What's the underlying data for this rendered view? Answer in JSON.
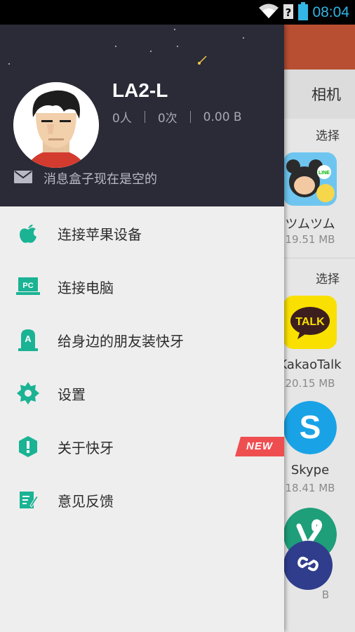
{
  "status_bar": {
    "time": "08:04",
    "icons": [
      "wifi-icon",
      "no-signal-icon",
      "battery-icon"
    ],
    "accent": "#33b5e5"
  },
  "background_app": {
    "tab_label": "相机",
    "sections": [
      {
        "select_label": "选择",
        "app_name": "ツムツム",
        "app_size": "19.51 MB",
        "icon": "tsum-tsum-app-icon"
      },
      {
        "select_label": "选择",
        "app_name": "KakaoTalk",
        "app_size": "20.15 MB",
        "icon": "kakaotalk-app-icon"
      },
      {
        "app_name": "Skype",
        "app_size": "18.41 MB",
        "icon": "skype-app-icon"
      },
      {
        "app_size_partial": "B",
        "icon": "vine-app-icon"
      }
    ],
    "kakao_icon_text": "TALK",
    "fab_icon": "link-icon",
    "header_color": "#b84f33"
  },
  "drawer": {
    "header_bg": "#2b2a37",
    "user": {
      "name": "LA2-L",
      "stats": [
        "0人",
        "0次",
        "0.00 B"
      ],
      "avatar_icon": "cartoon-avatar"
    },
    "inbox_text": "消息盒子现在是空的",
    "accent_color": "#1ab394",
    "menu": [
      {
        "label": "连接苹果设备",
        "icon": "apple-icon"
      },
      {
        "label": "连接电脑",
        "icon": "pc-icon",
        "icon_text": "PC"
      },
      {
        "label": "给身边的朋友装快牙",
        "icon": "install-icon",
        "icon_text": "A"
      },
      {
        "label": "设置",
        "icon": "gear-icon"
      },
      {
        "label": "关于快牙",
        "icon": "info-icon",
        "badge": "NEW",
        "badge_color": "#ef4e51"
      },
      {
        "label": "意见反馈",
        "icon": "feedback-icon"
      }
    ]
  }
}
